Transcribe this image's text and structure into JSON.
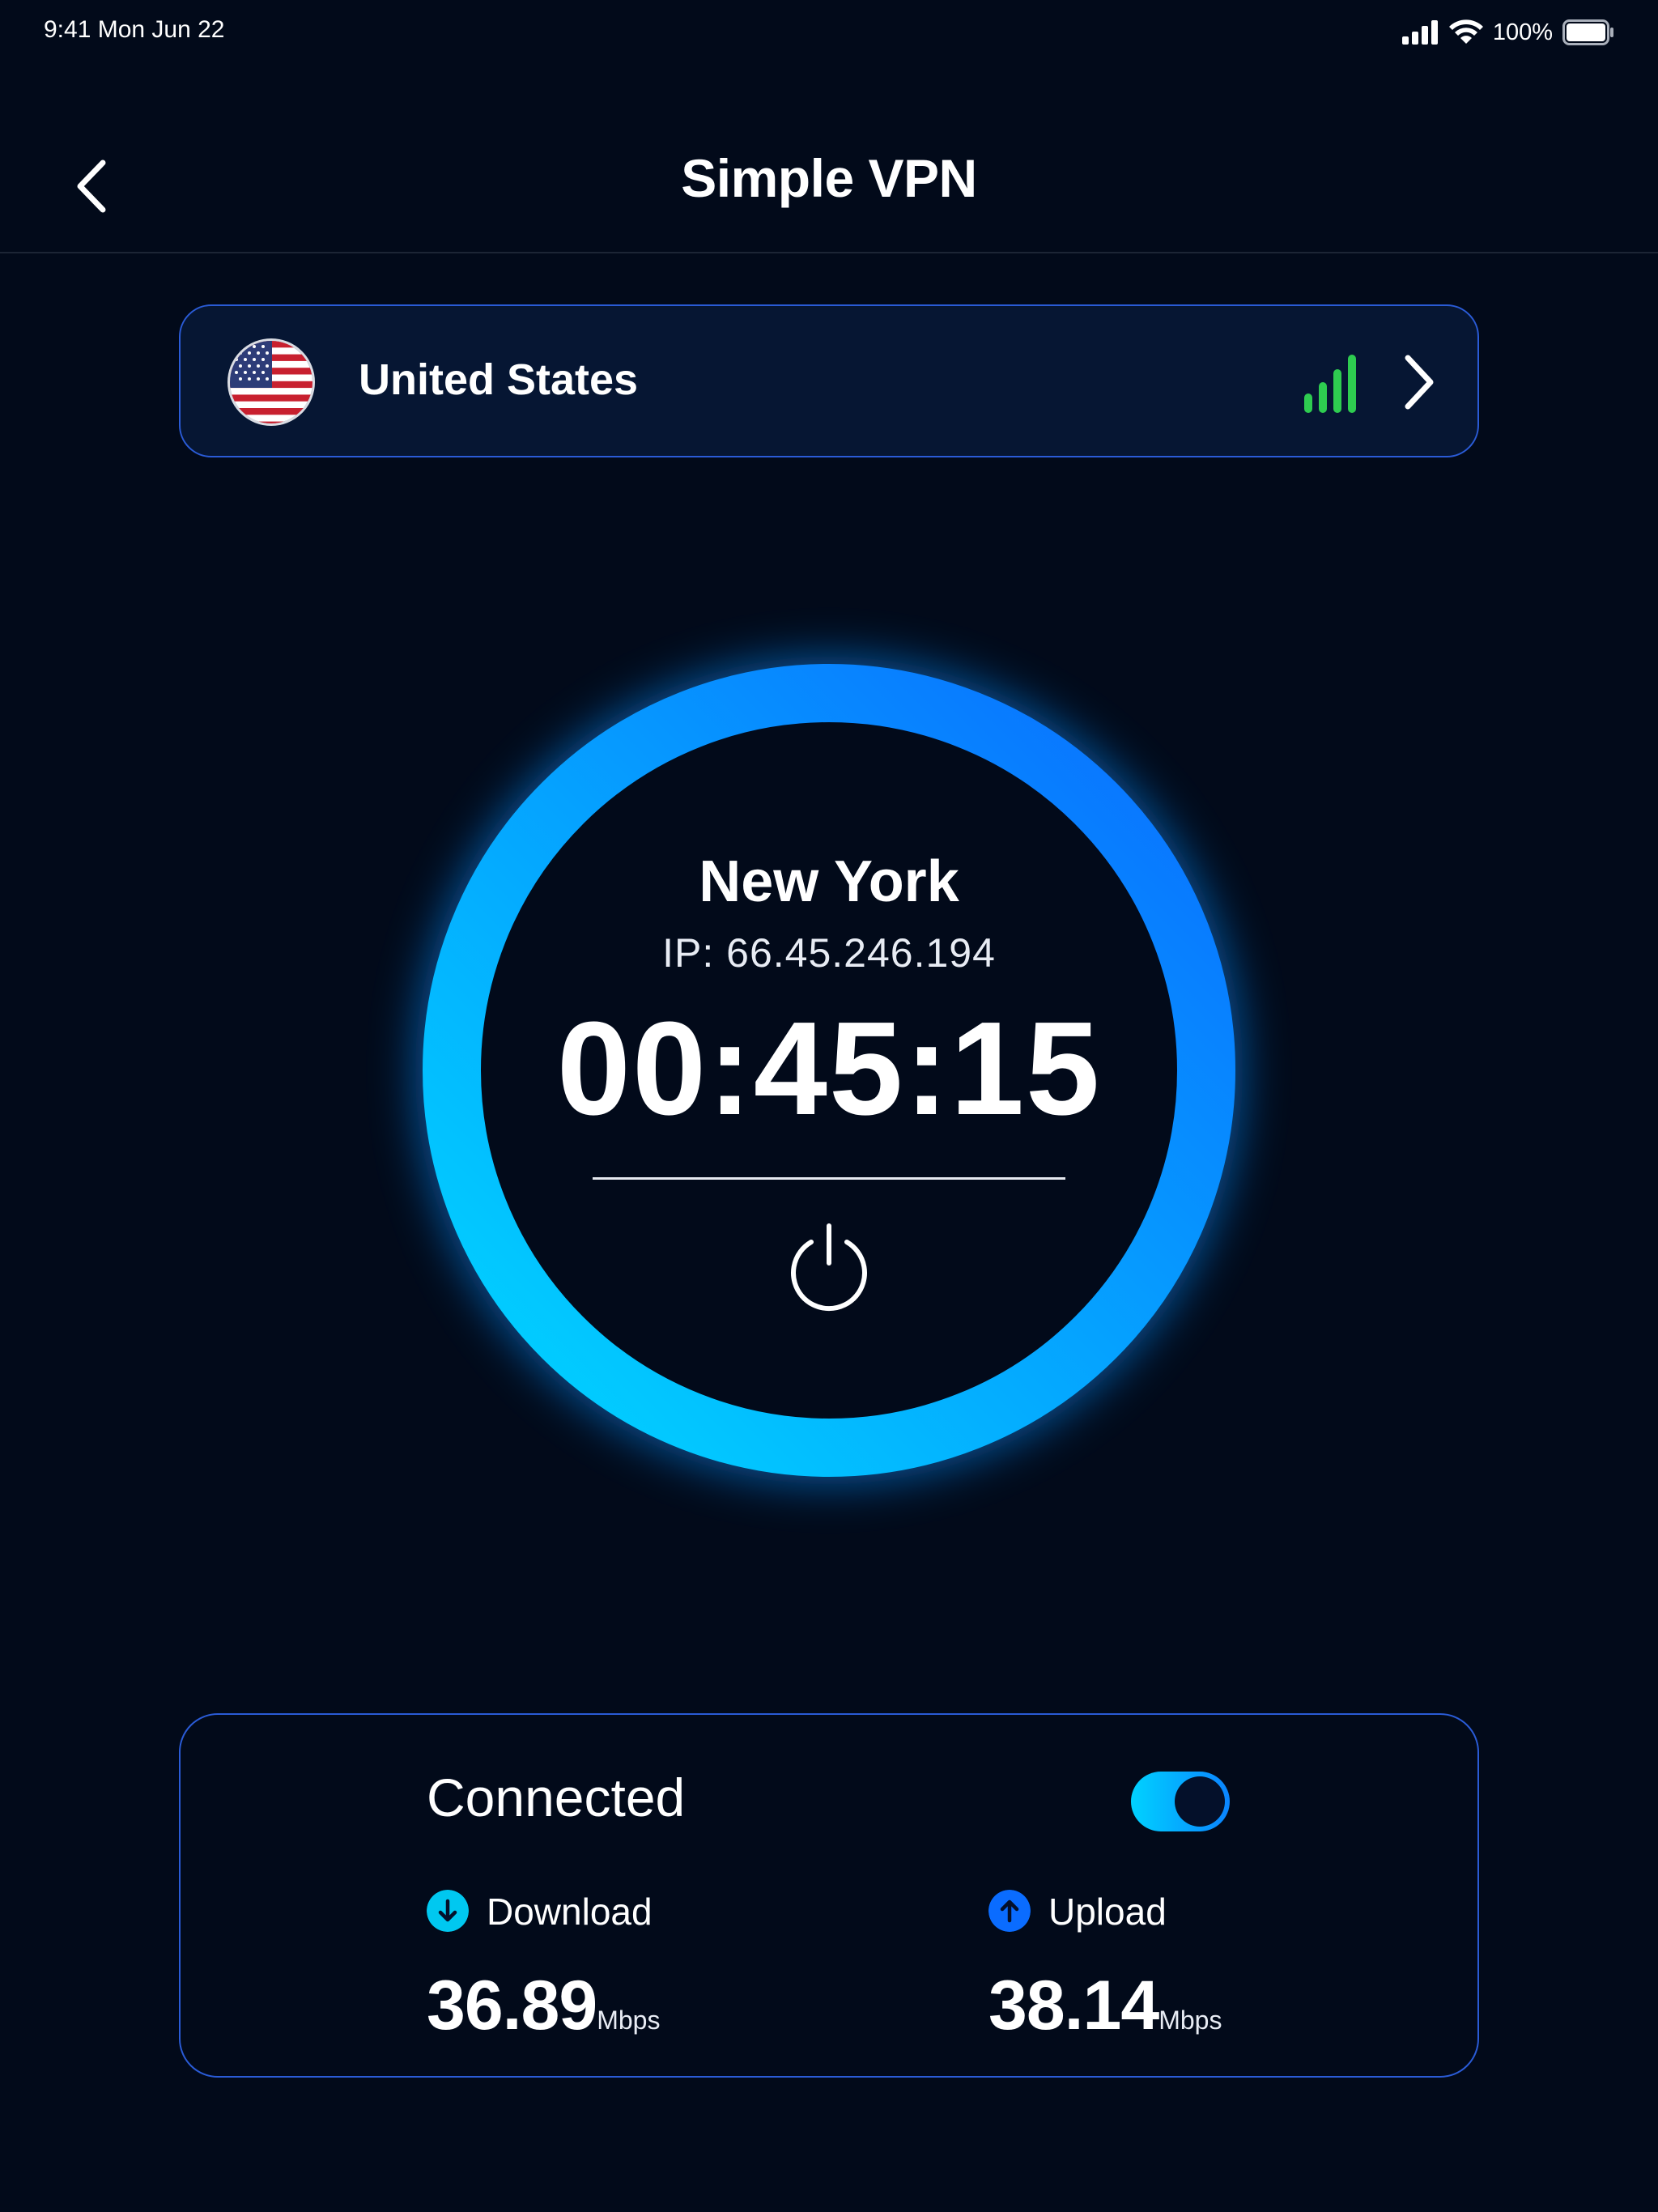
{
  "status_bar": {
    "time": "9:41  Mon Jun 22",
    "battery_percent": "100%",
    "icons": [
      "cellular-signal-icon",
      "wifi-icon",
      "battery-icon"
    ]
  },
  "header": {
    "title": "Simple VPN",
    "back_icon": "chevron-left-icon"
  },
  "location": {
    "country": "United States",
    "flag": "us-flag",
    "signal_icon": "signal-strength-icon",
    "signal_color": "#2ecc50",
    "chevron_icon": "chevron-right-icon"
  },
  "connection": {
    "city": "New York",
    "ip": "IP: 66.45.246.194",
    "duration": "00:45:15",
    "power_icon": "power-icon",
    "ring_gradient": [
      "#00d8ff",
      "#0a6cff"
    ]
  },
  "status": {
    "label": "Connected",
    "toggle_on": true,
    "download": {
      "label": "Download",
      "value": "36.89",
      "unit": "Mbps",
      "icon": "arrow-down-icon",
      "icon_color": "#00c8f0"
    },
    "upload": {
      "label": "Upload",
      "value": "38.14",
      "unit": "Mbps",
      "icon": "arrow-up-icon",
      "icon_color": "#0a6cff"
    }
  },
  "colors": {
    "background": "#020a1a",
    "card_border": "#2a5bd6",
    "card_fill": "#061633"
  }
}
